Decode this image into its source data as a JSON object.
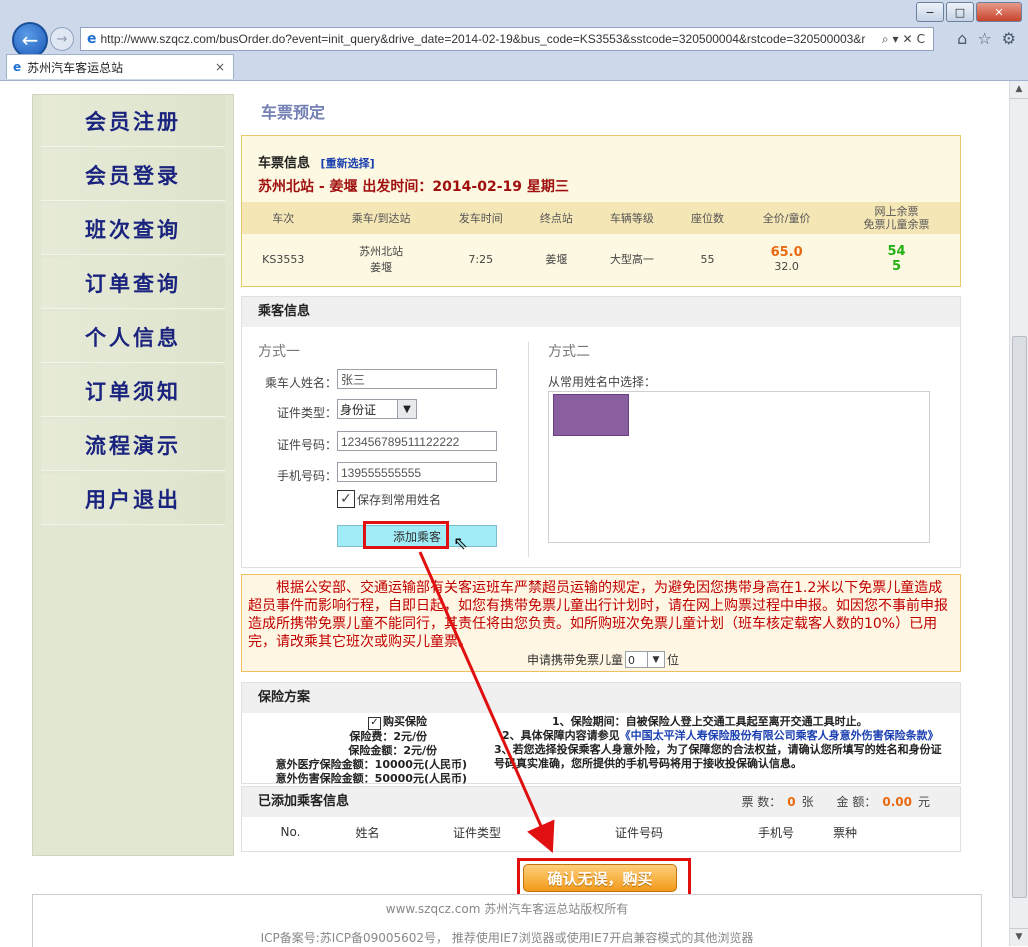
{
  "browser": {
    "url": "http://www.szqcz.com/busOrder.do?event=init_query&drive_date=2014-02-19&bus_code=KS3553&sstcode=320500004&rstcode=320500003&r",
    "tab_title": "苏州汽车客运总站",
    "tab_close": "×",
    "window_controls": [
      "−",
      "□",
      "✕"
    ],
    "addr_controls": "⌕▾✕C"
  },
  "sidebar": {
    "items": [
      "会员注册",
      "会员登录",
      "班次查询",
      "订单查询",
      "个人信息",
      "订单须知",
      "流程演示",
      "用户退出"
    ]
  },
  "page_title": "车票预定",
  "ticket": {
    "header": "车票信息",
    "reselect": "[重新选择]",
    "route": "苏州北站 - 姜堰 出发时间：2014-02-19 星期三",
    "columns": [
      "车次",
      "乘车/到达站",
      "发车时间",
      "终点站",
      "车辆等级",
      "座位数",
      "全价/童价",
      "网上余票\n免票儿童余票"
    ],
    "row": {
      "bus": "KS3553",
      "from": "苏州北站",
      "to": "姜堰",
      "time": "7:25",
      "terminal": "姜堰",
      "grade": "大型高一",
      "seats": "55",
      "full_price": "65.0",
      "child_price": "32.0",
      "remain": "54",
      "child_remain": "5"
    }
  },
  "passenger": {
    "header": "乘客信息",
    "mode1": "方式一",
    "mode2": "方式二",
    "name_label": "乘车人姓名：",
    "name_value": "张三",
    "idtype_label": "证件类型：",
    "idtype_value": "身份证",
    "idno_label": "证件号码：",
    "idno_value": "123456789511122222",
    "phone_label": "手机号码：",
    "phone_value": "139555555555",
    "save_label": "保存到常用姓名",
    "add_button": "添加乘客",
    "freq_label": "从常用姓名中选择："
  },
  "notice": {
    "text": "根据公安部、交通运输部有关客运班车严禁超员运输的规定，为避免因您携带身高在1.2米以下免票儿童造成超员事件而影响行程，自即日起，如您有携带免票儿童出行计划时，请在网上购票过程中申报。如因您不事前申报造成所携带免票儿童不能同行，其责任将由您负责。如所购班次免票儿童计划（班车核定载客人数的10%）已用完，请改乘其它班次或购买儿童票。",
    "child_label_pre": "申请携带免票儿童",
    "child_value": "0",
    "child_label_post": "位"
  },
  "insurance": {
    "header": "保险方案",
    "buy_label": "购买保险",
    "left_lines": [
      "保险费：2元/份",
      "保险金额：2元/份",
      "意外医疗保险金额：10000元(人民币)",
      "意外伤害保险金额：50000元(人民币)"
    ],
    "right_1": "1、保险期间：自被保险人登上交通工具起至离开交通工具时止。",
    "right_2_pre": "2、具体保障内容请参见",
    "right_2_link": "《中国太平洋人寿保险股份有限公司乘客人身意外伤害保险条款》",
    "right_3": "3、若您选择投保乘客人身意外险，为了保障您的合法权益，请确认您所填写的姓名和身份证号码真实准确，您所提供的手机号码将用于接收投保确认信息。"
  },
  "added": {
    "header": "已添加乘客信息",
    "tickets_label": "票 数：",
    "tickets_value": "0",
    "tickets_unit": "张",
    "amount_label": "金 额：",
    "amount_value": "0.00",
    "amount_unit": "元",
    "columns": [
      "No.",
      "姓名",
      "证件类型",
      "证件号码",
      "手机号",
      "票种"
    ]
  },
  "confirm_button": "确认无误，购买",
  "footer": {
    "line1": "www.szqcz.com 苏州汽车客运总站版权所有",
    "line2": "ICP备案号:苏ICP备09005602号， 推荐使用IE7浏览器或使用IE7开启兼容模式的其他浏览器"
  },
  "colors": {
    "accent_red": "#e01010",
    "sidebar_text": "#1a237e",
    "notice_text": "#c00000",
    "price_orange": "#e86a10",
    "remain_green": "#24b014"
  }
}
